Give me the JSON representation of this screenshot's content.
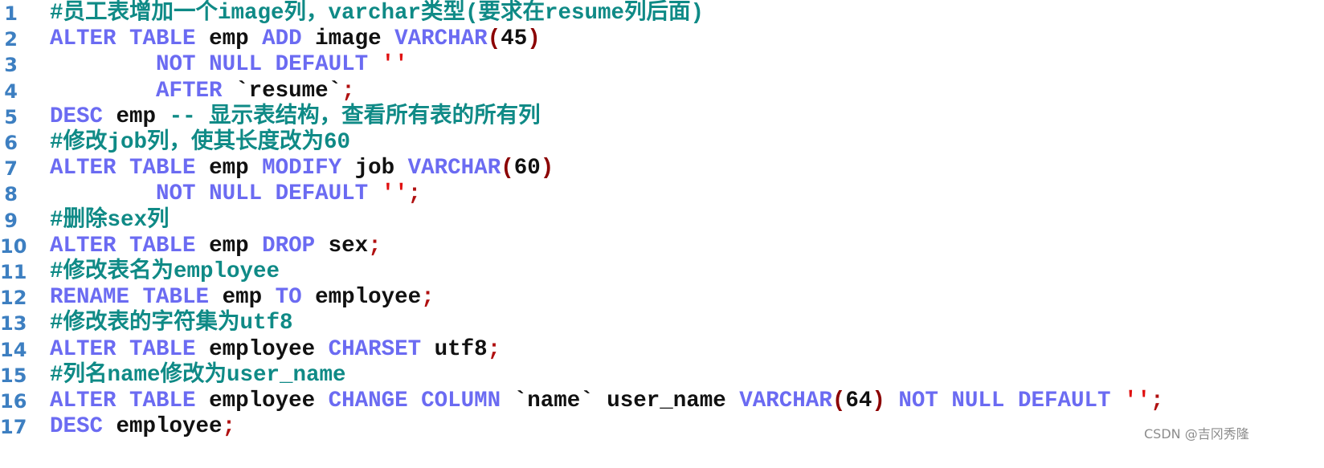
{
  "editor": {
    "language": "sql",
    "colors": {
      "keyword": "#6b6bf2",
      "identifier": "#111111",
      "comment": "#0f8a86",
      "paren": "#8b0000",
      "string": "#e01010",
      "line_number": "#3d7fc1"
    },
    "top_cut_text": "# … (partially visible previous line)",
    "lines": [
      {
        "n": "1",
        "tokens": [
          {
            "t": "cm",
            "v": "#员工表增加一个image列，varchar类型(要求在resume列后面)"
          }
        ]
      },
      {
        "n": "2",
        "tokens": [
          {
            "t": "kw",
            "v": "ALTER"
          },
          {
            "t": "sp",
            "v": " "
          },
          {
            "t": "kw",
            "v": "TABLE"
          },
          {
            "t": "sp",
            "v": " "
          },
          {
            "t": "id",
            "v": "emp"
          },
          {
            "t": "sp",
            "v": " "
          },
          {
            "t": "kw",
            "v": "ADD"
          },
          {
            "t": "sp",
            "v": " "
          },
          {
            "t": "id",
            "v": "image"
          },
          {
            "t": "sp",
            "v": " "
          },
          {
            "t": "kw",
            "v": "VARCHAR"
          },
          {
            "t": "paren",
            "v": "("
          },
          {
            "t": "num",
            "v": "45"
          },
          {
            "t": "paren",
            "v": ")"
          }
        ]
      },
      {
        "n": "3",
        "tokens": [
          {
            "t": "sp",
            "v": "        "
          },
          {
            "t": "kw",
            "v": "NOT"
          },
          {
            "t": "sp",
            "v": " "
          },
          {
            "t": "kw",
            "v": "NULL"
          },
          {
            "t": "sp",
            "v": " "
          },
          {
            "t": "kw",
            "v": "DEFAULT"
          },
          {
            "t": "sp",
            "v": " "
          },
          {
            "t": "str",
            "v": "''"
          }
        ]
      },
      {
        "n": "4",
        "tokens": [
          {
            "t": "sp",
            "v": "        "
          },
          {
            "t": "kw",
            "v": "AFTER"
          },
          {
            "t": "sp",
            "v": " "
          },
          {
            "t": "id",
            "v": "`resume`"
          },
          {
            "t": "semi",
            "v": ";"
          }
        ]
      },
      {
        "n": "5",
        "tokens": [
          {
            "t": "kw",
            "v": "DESC"
          },
          {
            "t": "sp",
            "v": " "
          },
          {
            "t": "id",
            "v": "emp"
          },
          {
            "t": "sp",
            "v": " "
          },
          {
            "t": "cm",
            "v": "-- 显示表结构，查看所有表的所有列"
          }
        ]
      },
      {
        "n": "6",
        "tokens": [
          {
            "t": "cm",
            "v": "#修改job列，使其长度改为60"
          }
        ]
      },
      {
        "n": "7",
        "tokens": [
          {
            "t": "kw",
            "v": "ALTER"
          },
          {
            "t": "sp",
            "v": " "
          },
          {
            "t": "kw",
            "v": "TABLE"
          },
          {
            "t": "sp",
            "v": " "
          },
          {
            "t": "id",
            "v": "emp"
          },
          {
            "t": "sp",
            "v": " "
          },
          {
            "t": "kw",
            "v": "MODIFY"
          },
          {
            "t": "sp",
            "v": " "
          },
          {
            "t": "id",
            "v": "job"
          },
          {
            "t": "sp",
            "v": " "
          },
          {
            "t": "kw",
            "v": "VARCHAR"
          },
          {
            "t": "paren",
            "v": "("
          },
          {
            "t": "num",
            "v": "60"
          },
          {
            "t": "paren",
            "v": ")"
          }
        ]
      },
      {
        "n": "8",
        "tokens": [
          {
            "t": "sp",
            "v": "        "
          },
          {
            "t": "kw",
            "v": "NOT"
          },
          {
            "t": "sp",
            "v": " "
          },
          {
            "t": "kw",
            "v": "NULL"
          },
          {
            "t": "sp",
            "v": " "
          },
          {
            "t": "kw",
            "v": "DEFAULT"
          },
          {
            "t": "sp",
            "v": " "
          },
          {
            "t": "str",
            "v": "''"
          },
          {
            "t": "semi",
            "v": ";"
          }
        ]
      },
      {
        "n": "9",
        "tokens": [
          {
            "t": "cm",
            "v": "#删除sex列"
          }
        ]
      },
      {
        "n": "10",
        "tokens": [
          {
            "t": "kw",
            "v": "ALTER"
          },
          {
            "t": "sp",
            "v": " "
          },
          {
            "t": "kw",
            "v": "TABLE"
          },
          {
            "t": "sp",
            "v": " "
          },
          {
            "t": "id",
            "v": "emp"
          },
          {
            "t": "sp",
            "v": " "
          },
          {
            "t": "kw",
            "v": "DROP"
          },
          {
            "t": "sp",
            "v": " "
          },
          {
            "t": "id",
            "v": "sex"
          },
          {
            "t": "semi",
            "v": ";"
          }
        ]
      },
      {
        "n": "11",
        "tokens": [
          {
            "t": "cm",
            "v": "#修改表名为employee"
          }
        ]
      },
      {
        "n": "12",
        "tokens": [
          {
            "t": "kw",
            "v": "RENAME"
          },
          {
            "t": "sp",
            "v": " "
          },
          {
            "t": "kw",
            "v": "TABLE"
          },
          {
            "t": "sp",
            "v": " "
          },
          {
            "t": "id",
            "v": "emp"
          },
          {
            "t": "sp",
            "v": " "
          },
          {
            "t": "kw",
            "v": "TO"
          },
          {
            "t": "sp",
            "v": " "
          },
          {
            "t": "id",
            "v": "employee"
          },
          {
            "t": "semi",
            "v": ";"
          }
        ]
      },
      {
        "n": "13",
        "tokens": [
          {
            "t": "cm",
            "v": "#修改表的字符集为utf8"
          }
        ]
      },
      {
        "n": "14",
        "tokens": [
          {
            "t": "kw",
            "v": "ALTER"
          },
          {
            "t": "sp",
            "v": " "
          },
          {
            "t": "kw",
            "v": "TABLE"
          },
          {
            "t": "sp",
            "v": " "
          },
          {
            "t": "id",
            "v": "employee"
          },
          {
            "t": "sp",
            "v": " "
          },
          {
            "t": "kw",
            "v": "CHARSET"
          },
          {
            "t": "sp",
            "v": " "
          },
          {
            "t": "id",
            "v": "utf8"
          },
          {
            "t": "semi",
            "v": ";"
          }
        ]
      },
      {
        "n": "15",
        "tokens": [
          {
            "t": "cm",
            "v": "#列名name修改为user_name"
          }
        ]
      },
      {
        "n": "16",
        "tokens": [
          {
            "t": "kw",
            "v": "ALTER"
          },
          {
            "t": "sp",
            "v": " "
          },
          {
            "t": "kw",
            "v": "TABLE"
          },
          {
            "t": "sp",
            "v": " "
          },
          {
            "t": "id",
            "v": "employee"
          },
          {
            "t": "sp",
            "v": " "
          },
          {
            "t": "kw",
            "v": "CHANGE"
          },
          {
            "t": "sp",
            "v": " "
          },
          {
            "t": "kw",
            "v": "COLUMN"
          },
          {
            "t": "sp",
            "v": " "
          },
          {
            "t": "id",
            "v": "`name`"
          },
          {
            "t": "sp",
            "v": " "
          },
          {
            "t": "id",
            "v": "user_name"
          },
          {
            "t": "sp",
            "v": " "
          },
          {
            "t": "kw",
            "v": "VARCHAR"
          },
          {
            "t": "paren",
            "v": "("
          },
          {
            "t": "num",
            "v": "64"
          },
          {
            "t": "paren",
            "v": ")"
          },
          {
            "t": "sp",
            "v": " "
          },
          {
            "t": "kw",
            "v": "NOT"
          },
          {
            "t": "sp",
            "v": " "
          },
          {
            "t": "kw",
            "v": "NULL"
          },
          {
            "t": "sp",
            "v": " "
          },
          {
            "t": "kw",
            "v": "DEFAULT"
          },
          {
            "t": "sp",
            "v": " "
          },
          {
            "t": "str",
            "v": "''"
          },
          {
            "t": "semi",
            "v": ";"
          }
        ]
      },
      {
        "n": "17",
        "tokens": [
          {
            "t": "kw",
            "v": "DESC"
          },
          {
            "t": "sp",
            "v": " "
          },
          {
            "t": "id",
            "v": "employee"
          },
          {
            "t": "semi",
            "v": ";"
          }
        ]
      }
    ]
  },
  "watermark": {
    "text": "CSDN @吉冈秀隆"
  }
}
